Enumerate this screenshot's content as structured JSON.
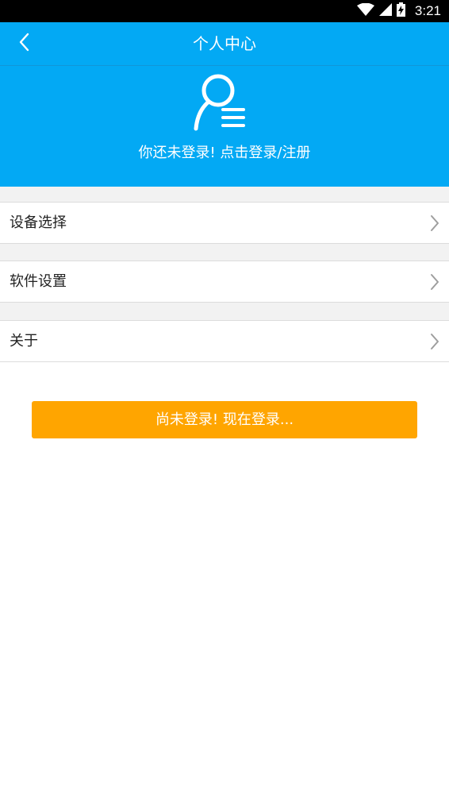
{
  "status_bar": {
    "time": "3:21",
    "icons": [
      "wifi-icon",
      "cell-signal-icon",
      "battery-charging-icon"
    ]
  },
  "header": {
    "title": "个人中心",
    "back_icon": "chevron-left-icon",
    "avatar_icon": "user-profile-icon",
    "login_prompt": "你还未登录! 点击登录/注册"
  },
  "menu": {
    "items": [
      {
        "label": "设备选择",
        "icon": "chevron-right-icon"
      },
      {
        "label": "软件设置",
        "icon": "chevron-right-icon"
      },
      {
        "label": "关于",
        "icon": "chevron-right-icon"
      }
    ]
  },
  "login_button": {
    "label": "尚未登录! 现在登录..."
  },
  "colors": {
    "header_blue": "#03a9f4",
    "button_orange": "#ffa500",
    "divider_gray": "#f2f2f2"
  }
}
